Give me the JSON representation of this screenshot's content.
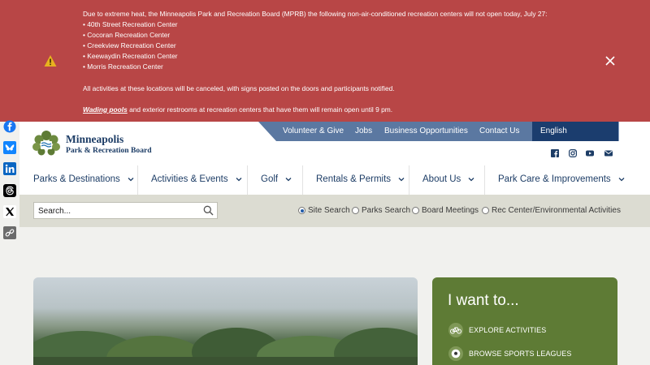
{
  "alert": {
    "intro": "Due to extreme heat, the Minneapolis Park and Recreation Board (MPRB) the following non-air-conditioned recreation centers will not open today, July 27:",
    "centers": [
      "• 40th Street Recreation Center",
      "• Cocoran Recreation Center",
      "• Creekview Recreation Center",
      "• Keewaydin Recreation Center",
      "• Morris Recreation Center"
    ],
    "activities_note": "All activities at these locations will be canceled, with signs posted on the doors and participants notified.",
    "pools_link": "Wading pools",
    "pools_note": " and exterior restrooms at recreation centers that have them will remain open until 9 pm.",
    "icon": "warning-icon",
    "color": "#b84646"
  },
  "share": [
    "facebook-icon",
    "bluesky-icon",
    "linkedin-icon",
    "threads-icon",
    "x-icon",
    "copy-link-icon"
  ],
  "logo": {
    "name": "Minneapolis",
    "subtitle": "Park & Recreation Board"
  },
  "utility_nav": [
    "Volunteer & Give",
    "Jobs",
    "Business Opportunities",
    "Contact Us"
  ],
  "language": "English",
  "social": [
    "facebook-icon",
    "instagram-icon",
    "youtube-icon",
    "email-icon"
  ],
  "main_nav": [
    "Parks & Destinations",
    "Activities & Events",
    "Golf",
    "Rentals & Permits",
    "About Us",
    "Park Care & Improvements"
  ],
  "search": {
    "placeholder": "Search...",
    "options": [
      "Site Search",
      "Parks Search",
      "Board Meetings",
      "Rec Center/Environmental Activities"
    ],
    "selected": "Site Search"
  },
  "iwant": {
    "title": "I want to...",
    "items": [
      "EXPLORE ACTIVITIES",
      "BROWSE SPORTS LEAGUES"
    ],
    "color": "#5e7b35"
  },
  "colors": {
    "navy": "#1d3d66",
    "utility": "#5b78a1"
  }
}
